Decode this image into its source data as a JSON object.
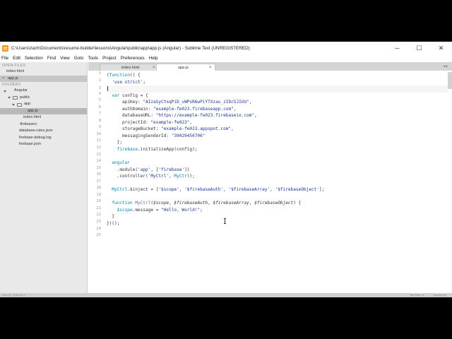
{
  "window": {
    "title": "C:\\Users\\zach\\Documents\\resume-builder\\lessons\\Angular\\public\\app\\app.js (Angular) - Sublime Text (UNREGISTERED)",
    "minimize": "─",
    "maximize": "☐",
    "close": "✕"
  },
  "menu": [
    "File",
    "Edit",
    "Selection",
    "Find",
    "View",
    "Goto",
    "Tools",
    "Project",
    "Preferences",
    "Help"
  ],
  "sidebar": {
    "open_files_heading": "OPEN FILES",
    "open_files": [
      "index.html",
      "app.js"
    ],
    "folders_heading": "FOLDERS",
    "tree": [
      {
        "label": "Angular",
        "type": "folder"
      },
      {
        "label": "public",
        "type": "folder"
      },
      {
        "label": "app",
        "type": "folder"
      },
      {
        "label": "app.js",
        "type": "file"
      },
      {
        "label": "index.html",
        "type": "file"
      },
      {
        "label": ".firebaserc",
        "type": "file"
      },
      {
        "label": "database.rules.json",
        "type": "file"
      },
      {
        "label": "firebase-debug.log",
        "type": "file"
      },
      {
        "label": "firebase.json",
        "type": "file"
      }
    ]
  },
  "tabs": [
    {
      "label": "index.html",
      "close": "×"
    },
    {
      "label": "app.js",
      "close": "×"
    }
  ],
  "tab_scroll": "◂ ▸",
  "editor": {
    "line_numbers": [
      "1",
      "2",
      "3",
      "4",
      "5",
      "6",
      "7",
      "8",
      "9",
      "10",
      "11",
      "12",
      "13",
      "14",
      "15",
      "16",
      "17",
      "18",
      "19",
      "20",
      "21",
      "22",
      "23",
      "24",
      "25"
    ],
    "lines": [
      [
        [
          "(",
          "def"
        ],
        [
          "function",
          "sto"
        ],
        [
          "() {",
          "def"
        ]
      ],
      [
        [
          "  ",
          "def"
        ],
        [
          "'use strict'",
          "str"
        ],
        [
          ";",
          "def"
        ]
      ],
      [],
      [
        [
          "  ",
          "def"
        ],
        [
          "var",
          "sto"
        ],
        [
          " config = {",
          "def"
        ]
      ],
      [
        [
          "      apiKey: ",
          "def"
        ],
        [
          "\"AIzaSyCtxqPiD_vWPsR6wPiYTXzau_zIDc5JIUU\"",
          "str"
        ],
        [
          ",",
          "def"
        ]
      ],
      [
        [
          "      authDomain: ",
          "def"
        ],
        [
          "\"example-fe023.firebaseapp.com\"",
          "str"
        ],
        [
          ",",
          "def"
        ]
      ],
      [
        [
          "      databaseURL: ",
          "def"
        ],
        [
          "\"https://example-fe023.firebaseio.com\"",
          "str"
        ],
        [
          ",",
          "def"
        ]
      ],
      [
        [
          "      projectId: ",
          "def"
        ],
        [
          "\"example-fe023\"",
          "str"
        ],
        [
          ",",
          "def"
        ]
      ],
      [
        [
          "      storageBucket: ",
          "def"
        ],
        [
          "\"example-fe023.appspot.com\"",
          "str"
        ],
        [
          ",",
          "def"
        ]
      ],
      [
        [
          "      messagingSenderId: ",
          "def"
        ],
        [
          "\"39029456706\"",
          "str"
        ]
      ],
      [
        [
          "    };",
          "def"
        ]
      ],
      [
        [
          "    firebase",
          "sto"
        ],
        [
          ".initializeApp(config);",
          "def"
        ]
      ],
      [],
      [
        [
          "  angular",
          "sto"
        ]
      ],
      [
        [
          "    .module(",
          "def"
        ],
        [
          "'app'",
          "str"
        ],
        [
          ", [",
          "def"
        ],
        [
          "'firebase'",
          "str"
        ],
        [
          "])",
          "def"
        ]
      ],
      [
        [
          "    .controller(",
          "def"
        ],
        [
          "'MyCtrl'",
          "str"
        ],
        [
          ", ",
          "def"
        ],
        [
          "MyCtrl",
          "sto"
        ],
        [
          ");",
          "def"
        ]
      ],
      [],
      [
        [
          "  MyCtrl",
          "sto"
        ],
        [
          ".$inject = [",
          "def"
        ],
        [
          "'$scope'",
          "str"
        ],
        [
          ", ",
          "def"
        ],
        [
          "'$firebaseAuth'",
          "str"
        ],
        [
          ", ",
          "def"
        ],
        [
          "'$firebaseArray'",
          "str"
        ],
        [
          ", ",
          "def"
        ],
        [
          "'$firebaseObject'",
          "str"
        ],
        [
          "];",
          "def"
        ]
      ],
      [],
      [
        [
          "  ",
          "def"
        ],
        [
          "function",
          "sto"
        ],
        [
          " ",
          "def"
        ],
        [
          "MyCtrl",
          "fn"
        ],
        [
          "(",
          "def"
        ],
        [
          "$scope",
          "par"
        ],
        [
          ", ",
          "def"
        ],
        [
          "$firebaseAuth",
          "par"
        ],
        [
          ", ",
          "def"
        ],
        [
          "$firebaseArray",
          "par"
        ],
        [
          ", ",
          "def"
        ],
        [
          "$firebaseObject",
          "par"
        ],
        [
          ") {",
          "def"
        ]
      ],
      [
        [
          "    ",
          "def"
        ],
        [
          "$scope",
          "var"
        ],
        [
          ".message = ",
          "def"
        ],
        [
          "\"Hello, World!\"",
          "str"
        ],
        [
          ";",
          "def"
        ]
      ],
      [
        [
          "  }",
          "def"
        ]
      ],
      [
        [
          "})();",
          "def"
        ]
      ],
      [],
      []
    ]
  },
  "status": {
    "left": "Line 22, Column 4",
    "spaces": "Tab Size: 4",
    "syntax": "JavaScript"
  },
  "colors": {
    "keyword": "#a71d5d",
    "storage": "#0086b3",
    "string": "#183691",
    "function_name": "#795da3"
  }
}
